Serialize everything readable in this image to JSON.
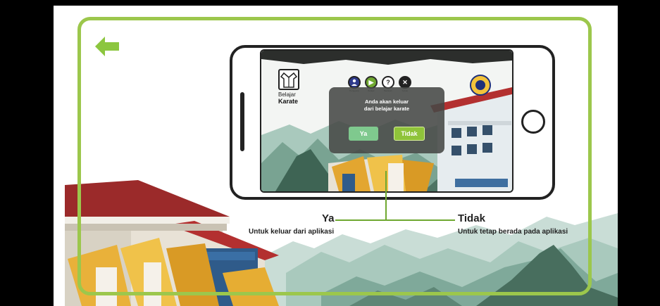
{
  "phone_screen": {
    "logo": {
      "line1": "Belajar",
      "line2": "Karate"
    },
    "menu_icons": [
      {
        "icon": "person-icon",
        "glyph": "",
        "label": "Pengguna"
      },
      {
        "icon": "play-icon",
        "glyph": "▶",
        "label": "Belajar"
      },
      {
        "icon": "help-icon",
        "glyph": "?",
        "label": "Bantuan"
      },
      {
        "icon": "close-icon",
        "glyph": "✕",
        "label": "Keluar"
      }
    ],
    "dialog": {
      "message_line1": "Anda akan keluar",
      "message_line2": "dari belajar karate",
      "yes_label": "Ya",
      "no_label": "Tidak"
    }
  },
  "annotations": {
    "yes": {
      "title": "Ya",
      "description": "Untuk keluar dari aplikasi"
    },
    "no": {
      "title": "Tidak",
      "description": "Untuk tetap berada pada aplikasi"
    }
  },
  "colors": {
    "frame": "#9cc74c",
    "back_arrow": "#8cc63f",
    "yes_button": "#7fc98e",
    "no_button": "#8fc33a",
    "dialog_bg": "#464846"
  }
}
